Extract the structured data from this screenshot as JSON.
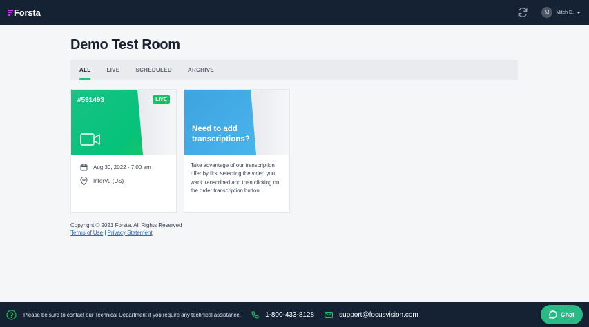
{
  "header": {
    "logo_text": "Forsta",
    "user_initial": "M",
    "user_name": "Mitch D."
  },
  "page": {
    "title": "Demo Test Room"
  },
  "tabs": [
    {
      "label": "ALL",
      "active": true
    },
    {
      "label": "LIVE",
      "active": false
    },
    {
      "label": "SCHEDULED",
      "active": false
    },
    {
      "label": "ARCHIVE",
      "active": false
    }
  ],
  "session_card": {
    "room_id": "#591493",
    "status_badge": "LIVE",
    "date": "Aug 30, 2022 - 7:00 am",
    "location": "InterVu (US)"
  },
  "promo_card": {
    "headline": "Need to add transcriptions?",
    "description": "Take advantage of our transcription offer by first selecting the video you want transcribed and then clicking on the order transcription button."
  },
  "copyright": {
    "text": "Copyright © 2021 Forsta. All Rights Reserved",
    "terms_link": "Terms of Use",
    "separator": "|",
    "privacy_link": "Privacy Statement"
  },
  "footer": {
    "notice": "Please be sure to contact our Technical Department if you require any technical assistance.",
    "phone": "1-800-433-8128",
    "email": "support@focusvision.com",
    "chat_label": "Chat"
  },
  "colors": {
    "nav_bg": "#152234",
    "accent_green": "#19c37d",
    "link_blue": "#2b6cb0",
    "chat_green": "#29bb86"
  }
}
